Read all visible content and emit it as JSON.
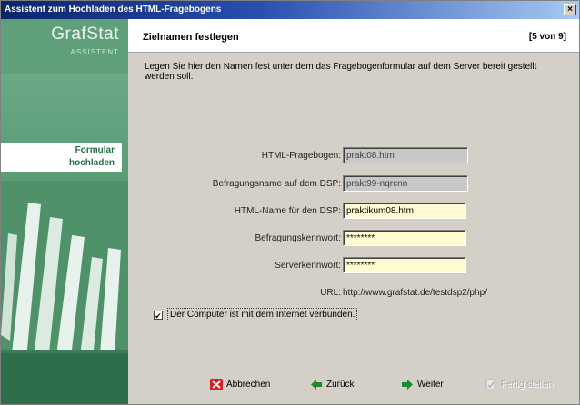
{
  "window": {
    "title": "Assistent zum Hochladen des HTML-Fragebogens",
    "close_label": "×"
  },
  "sidebar": {
    "brand": "GrafStat",
    "subtitle": "ASSISTENT",
    "active_step": "Formular\nhochladen"
  },
  "header": {
    "title": "Zielnamen festlegen",
    "progress": "[5 von 9]"
  },
  "description": "Legen Sie hier den Namen fest unter dem das Fragebogenformular auf dem Server bereit gestellt werden soll.",
  "fields": {
    "html_fragebogen": {
      "label": "HTML-Fragebogen:",
      "value": "prakt08.htm"
    },
    "befragungsname": {
      "label": "Befragungsname auf dem DSP:",
      "value": "prakt99-nqrcnn"
    },
    "html_name": {
      "label": "HTML-Name für den DSP:",
      "value": "praktikum08.htm"
    },
    "befragungskennwort": {
      "label": "Befragungskennwort:",
      "value": "********"
    },
    "serverkennwort": {
      "label": "Serverkennwort:",
      "value": "********"
    }
  },
  "url": {
    "label": "URL:",
    "value": "http://www.grafstat.de/testdsp2/php/"
  },
  "checkbox": {
    "label": "Der Computer ist mit dem Internet verbunden.",
    "checked_mark": "✔"
  },
  "buttons": {
    "cancel": "Abbrechen",
    "back": "Zurück",
    "next": "Weiter",
    "finish": "Fertig stellen"
  },
  "colors": {
    "title_bar": "#0a246a",
    "sidebar": "#5f9f7a",
    "editable_field": "#fffbd0",
    "readonly_field": "#c8c8c8"
  }
}
